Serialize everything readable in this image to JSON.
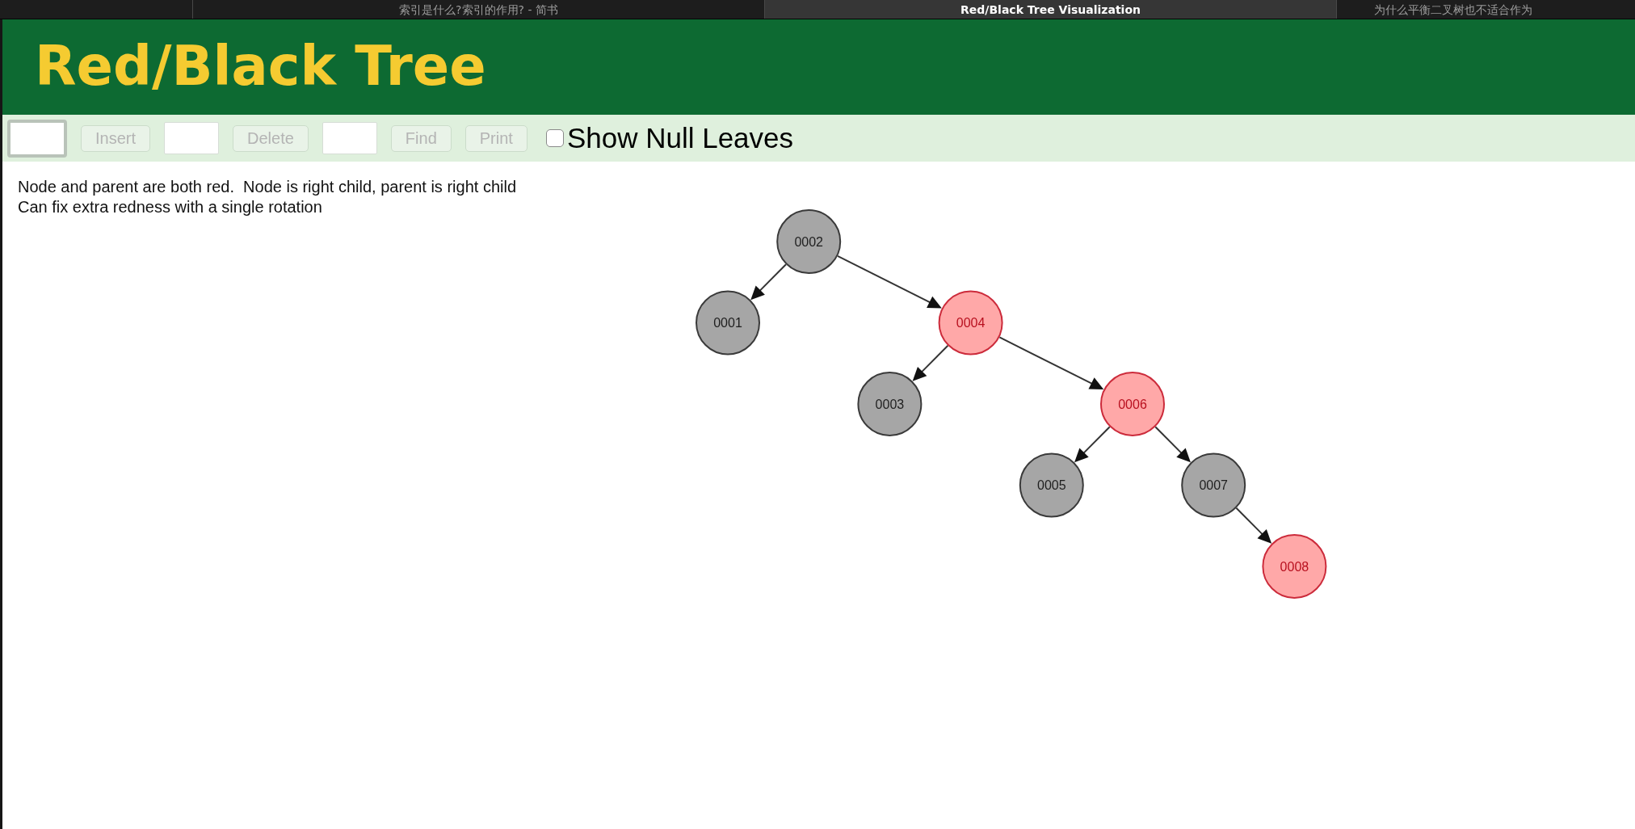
{
  "browser_tabs": [
    {
      "title": "索引是什么?索引的作用? - 简书",
      "selected": false
    },
    {
      "title": "Red/Black Tree Visualization",
      "selected": true
    },
    {
      "title": "为什么平衡二叉树也不适合作为",
      "selected": false
    }
  ],
  "header": {
    "title": "Red/Black Tree"
  },
  "toolbar": {
    "items": [
      {
        "kind": "field",
        "focused": true
      },
      {
        "kind": "button",
        "label": "Insert",
        "disabled": true
      },
      {
        "kind": "field",
        "focused": false
      },
      {
        "kind": "button",
        "label": "Delete",
        "disabled": true
      },
      {
        "kind": "field",
        "focused": false
      },
      {
        "kind": "button",
        "label": "Find",
        "disabled": true
      },
      {
        "kind": "button",
        "label": "Print",
        "disabled": true
      },
      {
        "kind": "checkbox",
        "label": "Show Null Leaves",
        "checked": false
      }
    ]
  },
  "messages": [
    "Node and parent are both red.  Node is right child, parent is right child",
    "Can fix extra redness with a single rotation"
  ],
  "tree": {
    "root": {
      "value": "0002",
      "color": "#a6a6a6",
      "children": [
        {
          "kind": "left",
          "value": "0001",
          "color": "#a6a6a6"
        },
        {
          "kind": "right",
          "value": "0004",
          "color": "#ffa8a8",
          "children": [
            {
              "kind": "left",
              "value": "0003",
              "color": "#a6a6a6"
            },
            {
              "kind": "right",
              "value": "0006",
              "color": "#ffa8a8",
              "children": [
                {
                  "kind": "left",
                  "value": "0005",
                  "color": "#a6a6a6"
                },
                {
                  "kind": "right",
                  "value": "0007",
                  "color": "#a6a6a6",
                  "children": [
                    {
                      "kind": "right",
                      "value": "0008",
                      "color": "#ffa8a8"
                    }
                  ]
                }
              ]
            }
          ]
        }
      ]
    }
  }
}
